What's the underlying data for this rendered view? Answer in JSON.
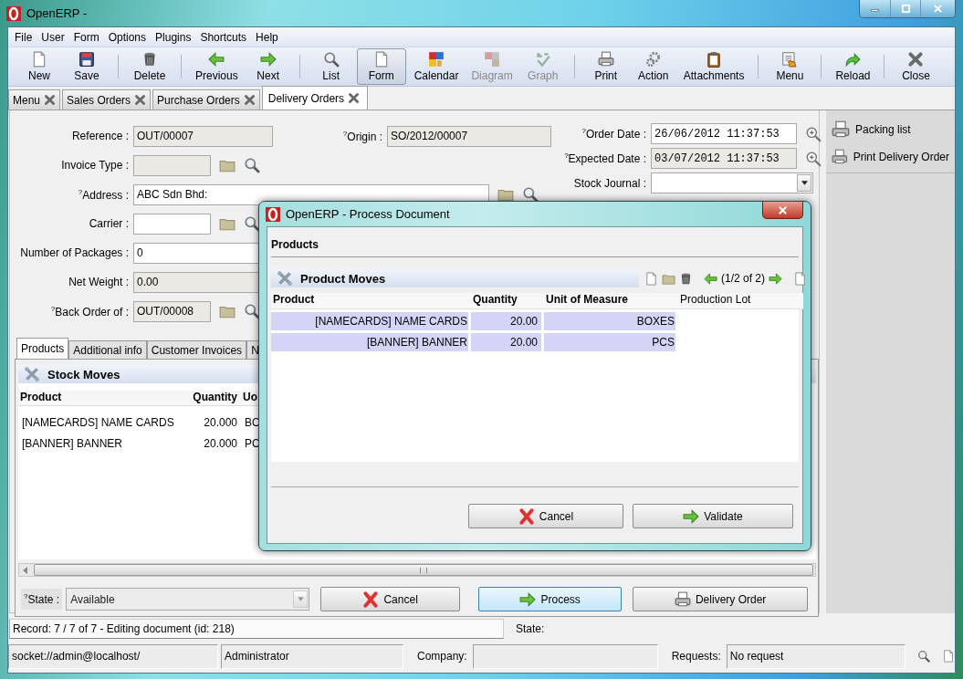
{
  "window": {
    "title": "OpenERP -"
  },
  "menu": [
    "File",
    "User",
    "Form",
    "Options",
    "Plugins",
    "Shortcuts",
    "Help"
  ],
  "toolbar": {
    "groups": [
      [
        {
          "label": "New",
          "selected": false,
          "disabled": false
        },
        {
          "label": "Save",
          "selected": false,
          "disabled": false
        }
      ],
      [
        {
          "label": "Delete",
          "selected": false,
          "disabled": false
        }
      ],
      [
        {
          "label": "Previous",
          "selected": false,
          "disabled": false
        },
        {
          "label": "Next",
          "selected": false,
          "disabled": false
        }
      ],
      [
        {
          "label": "List",
          "selected": false,
          "disabled": false
        },
        {
          "label": "Form",
          "selected": true,
          "disabled": false
        },
        {
          "label": "Calendar",
          "selected": false,
          "disabled": false
        },
        {
          "label": "Diagram",
          "selected": false,
          "disabled": true
        },
        {
          "label": "Graph",
          "selected": false,
          "disabled": true
        }
      ],
      [
        {
          "label": "Print",
          "selected": false,
          "disabled": false
        },
        {
          "label": "Action",
          "selected": false,
          "disabled": false
        },
        {
          "label": "Attachments",
          "selected": false,
          "disabled": false
        }
      ],
      [
        {
          "label": "Menu",
          "selected": false,
          "disabled": false
        }
      ],
      [
        {
          "label": "Reload",
          "selected": false,
          "disabled": false
        }
      ],
      [
        {
          "label": "Close",
          "selected": false,
          "disabled": false
        }
      ]
    ]
  },
  "tabs": [
    {
      "label": "Menu",
      "selected": false
    },
    {
      "label": "Sales Orders",
      "selected": false
    },
    {
      "label": "Purchase Orders",
      "selected": false
    },
    {
      "label": "Delivery Orders",
      "selected": true
    }
  ],
  "form": {
    "left_rows": [
      [
        {
          "kind": "text",
          "label": "Reference :",
          "value": "OUT/00007",
          "readonly": true
        },
        {
          "kind": "text",
          "label": "$^{?}$Origin :",
          "value": "SO/2012/00007",
          "readonly": true
        }
      ],
      [
        {
          "kind": "relation",
          "label": "Invoice Type :",
          "readonly": true
        }
      ],
      [
        {
          "kind": "relation",
          "label": "$^{?}$Address :",
          "value": "ABC Sdn Bhd:",
          "readonly": false
        }
      ],
      [
        {
          "kind": "relation",
          "label": "Carrier :",
          "readonly": false
        }
      ],
      [
        {
          "kind": "text",
          "label": "Number of Packages :",
          "value": "0",
          "readonly": false
        }
      ],
      [
        {
          "kind": "text",
          "label": "Net Weight :",
          "value": "0.00",
          "readonly": true
        }
      ],
      [
        {
          "kind": "relation",
          "label": "$^{?}$Back Order of :",
          "value": "OUT/00008",
          "readonly": true
        }
      ]
    ],
    "right_rows": [
      [
        {
          "kind": "date",
          "label": "$^{?}$Order Date :",
          "value": "26/06/2012 11:37:53",
          "readonly": false
        }
      ],
      [
        {
          "kind": "date",
          "label": "$^{?}$Expected Date :",
          "value": "03/07/2012 11:37:53",
          "readonly": true
        }
      ],
      [
        {
          "kind": "select",
          "label": "Stock Journal :",
          "readonly": false
        }
      ]
    ]
  },
  "notebook": {
    "tabs": [
      {
        "label": "Products",
        "selected": true
      },
      {
        "label": "Additional info",
        "selected": false
      },
      {
        "label": "Customer Invoices",
        "selected": false
      },
      {
        "label": "N",
        "selected": false
      }
    ],
    "list_title": "Stock Moves",
    "columns": [
      "Product",
      "Quantity",
      "Uo"
    ],
    "rows": [
      [
        "[NAMECARDS] NAME CARDS",
        "20.000",
        "BO"
      ],
      [
        "[BANNER] BANNER",
        "20.000",
        "PC"
      ]
    ],
    "state": {
      "label": "$^{?}$State :",
      "value": "Available"
    },
    "buttons": [
      {
        "label": "Cancel",
        "focused": false
      },
      {
        "label": "Process",
        "focused": true
      },
      {
        "label": "Delivery Order",
        "focused": false
      }
    ]
  },
  "sidebar": {
    "actions": [
      "Packing list",
      "Print Delivery Order"
    ]
  },
  "status": {
    "record": "Record: 7 / 7 of 7 - Editing document (id: 218)",
    "state_label": "State:",
    "connection": "socket://admin@localhost/",
    "user": "Administrator",
    "company_label": "Company:",
    "requests_label": "Requests:",
    "requests": "No request"
  },
  "dialog": {
    "title": "OpenERP - Process Document",
    "section": "Products",
    "list_title": "Product Moves",
    "pager": "(1/2 of 2)",
    "columns": [
      {
        "label": "Product",
        "required": true
      },
      {
        "label": "Quantity",
        "required": true
      },
      {
        "label": "Unit of Measure",
        "required": true
      },
      {
        "label": "Production Lot",
        "required": false
      }
    ],
    "rows": [
      {
        "cells": [
          "[NAMECARDS] NAME CARDS",
          "20.00",
          "BOXES"
        ],
        "selected": true
      },
      {
        "cells": [
          "[BANNER] BANNER",
          "20.00",
          "PCS"
        ],
        "selected": true
      }
    ],
    "buttons": [
      "Cancel",
      "Validate"
    ]
  }
}
